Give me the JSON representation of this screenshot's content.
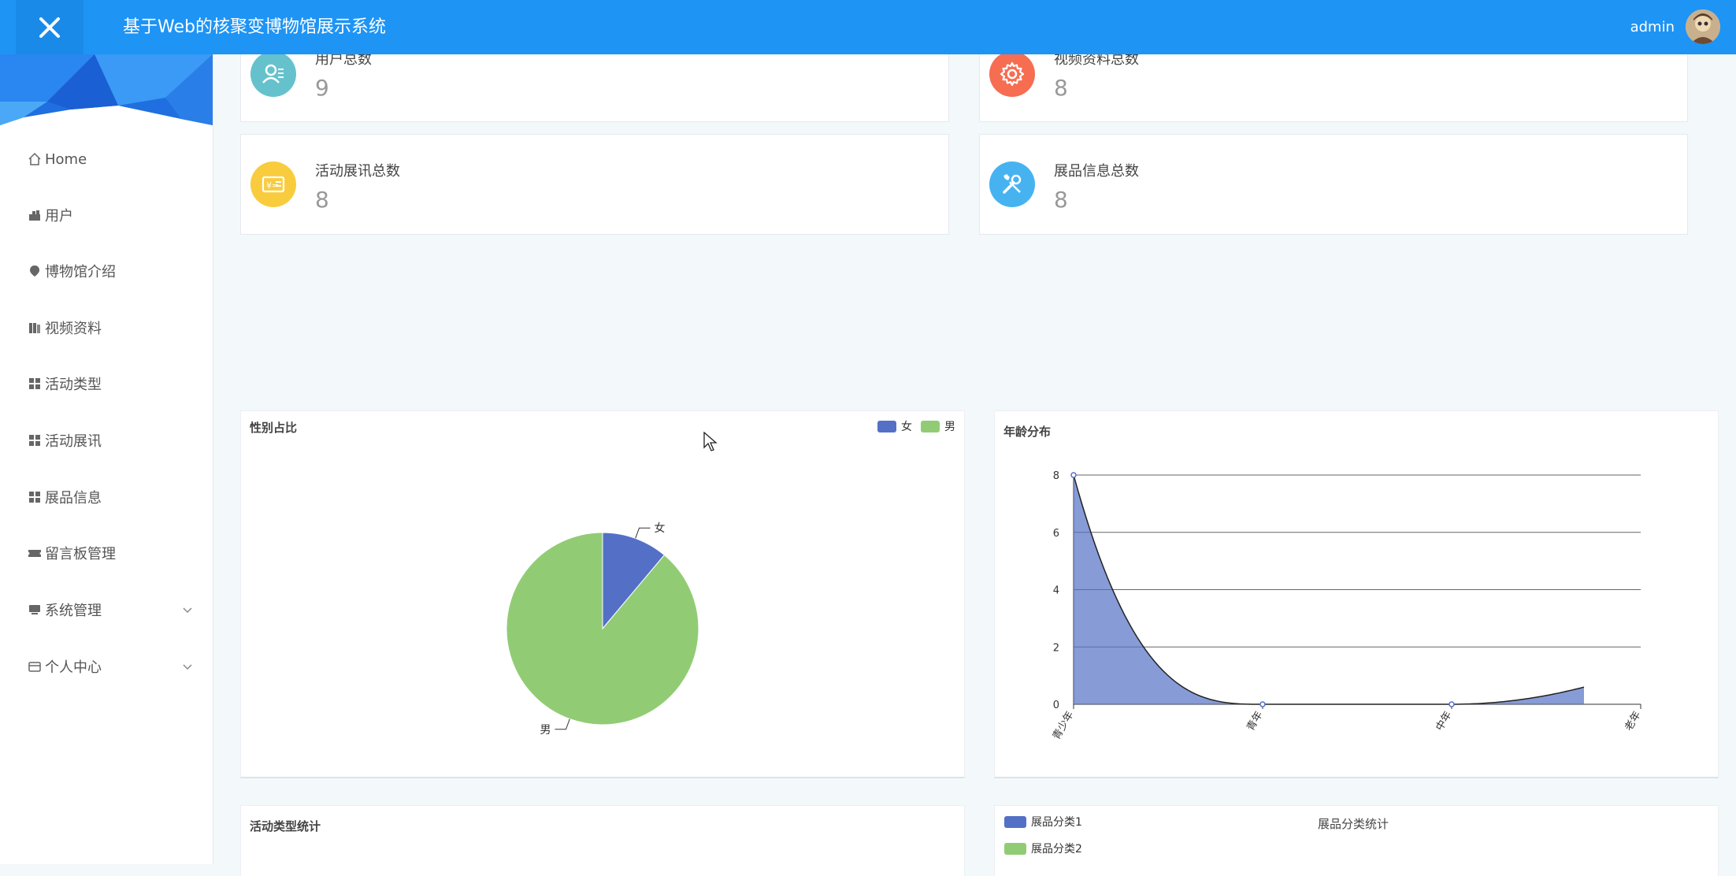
{
  "header": {
    "title": "基于Web的核聚变博物馆展示系统",
    "username": "admin"
  },
  "sidebar": {
    "items": [
      {
        "label": "Home",
        "icon": "home-icon"
      },
      {
        "label": "用户",
        "icon": "user-icon"
      },
      {
        "label": "博物馆介绍",
        "icon": "location-icon"
      },
      {
        "label": "视频资料",
        "icon": "video-icon"
      },
      {
        "label": "活动类型",
        "icon": "grid-icon"
      },
      {
        "label": "活动展讯",
        "icon": "grid-icon"
      },
      {
        "label": "展品信息",
        "icon": "grid-icon"
      },
      {
        "label": "留言板管理",
        "icon": "ticket-icon"
      },
      {
        "label": "系统管理",
        "icon": "monitor-icon",
        "expandable": true
      },
      {
        "label": "个人中心",
        "icon": "wallet-icon",
        "expandable": true
      }
    ]
  },
  "stats": [
    {
      "label": "用户总数",
      "value": "9",
      "color": "#65c2cd"
    },
    {
      "label": "视频资料总数",
      "value": "8",
      "color": "#f66d52"
    },
    {
      "label": "活动展讯总数",
      "value": "8",
      "color": "#f9cc3e"
    },
    {
      "label": "展品信息总数",
      "value": "8",
      "color": "#46b3f0"
    }
  ],
  "charts": {
    "gender": {
      "title": "性别占比"
    },
    "age": {
      "title": "年龄分布"
    },
    "activity": {
      "title": "活动类型统计"
    },
    "exhibit": {
      "title": "展品分类统计"
    }
  },
  "chart_data": [
    {
      "type": "pie",
      "title": "性别占比",
      "categories": [
        "女",
        "男"
      ],
      "values": [
        1,
        8
      ],
      "colors": [
        "#5470c6",
        "#91cc75"
      ],
      "legend": "top-right"
    },
    {
      "type": "area",
      "title": "年龄分布",
      "categories": [
        "青少年",
        "青年",
        "中年",
        "老年"
      ],
      "values": [
        8,
        0,
        0,
        0.6
      ],
      "ylim": [
        0,
        8
      ],
      "yticks": [
        0,
        2,
        4,
        6,
        8
      ],
      "grid": true,
      "color": "#5470c6"
    },
    {
      "type": "bar",
      "title": "活动类型统计"
    },
    {
      "type": "bar",
      "title": "展品分类统计",
      "series": [
        {
          "name": "展品分类1",
          "color": "#5470c6"
        },
        {
          "name": "展品分类2",
          "color": "#91cc75"
        }
      ],
      "legend": "top-left"
    }
  ]
}
